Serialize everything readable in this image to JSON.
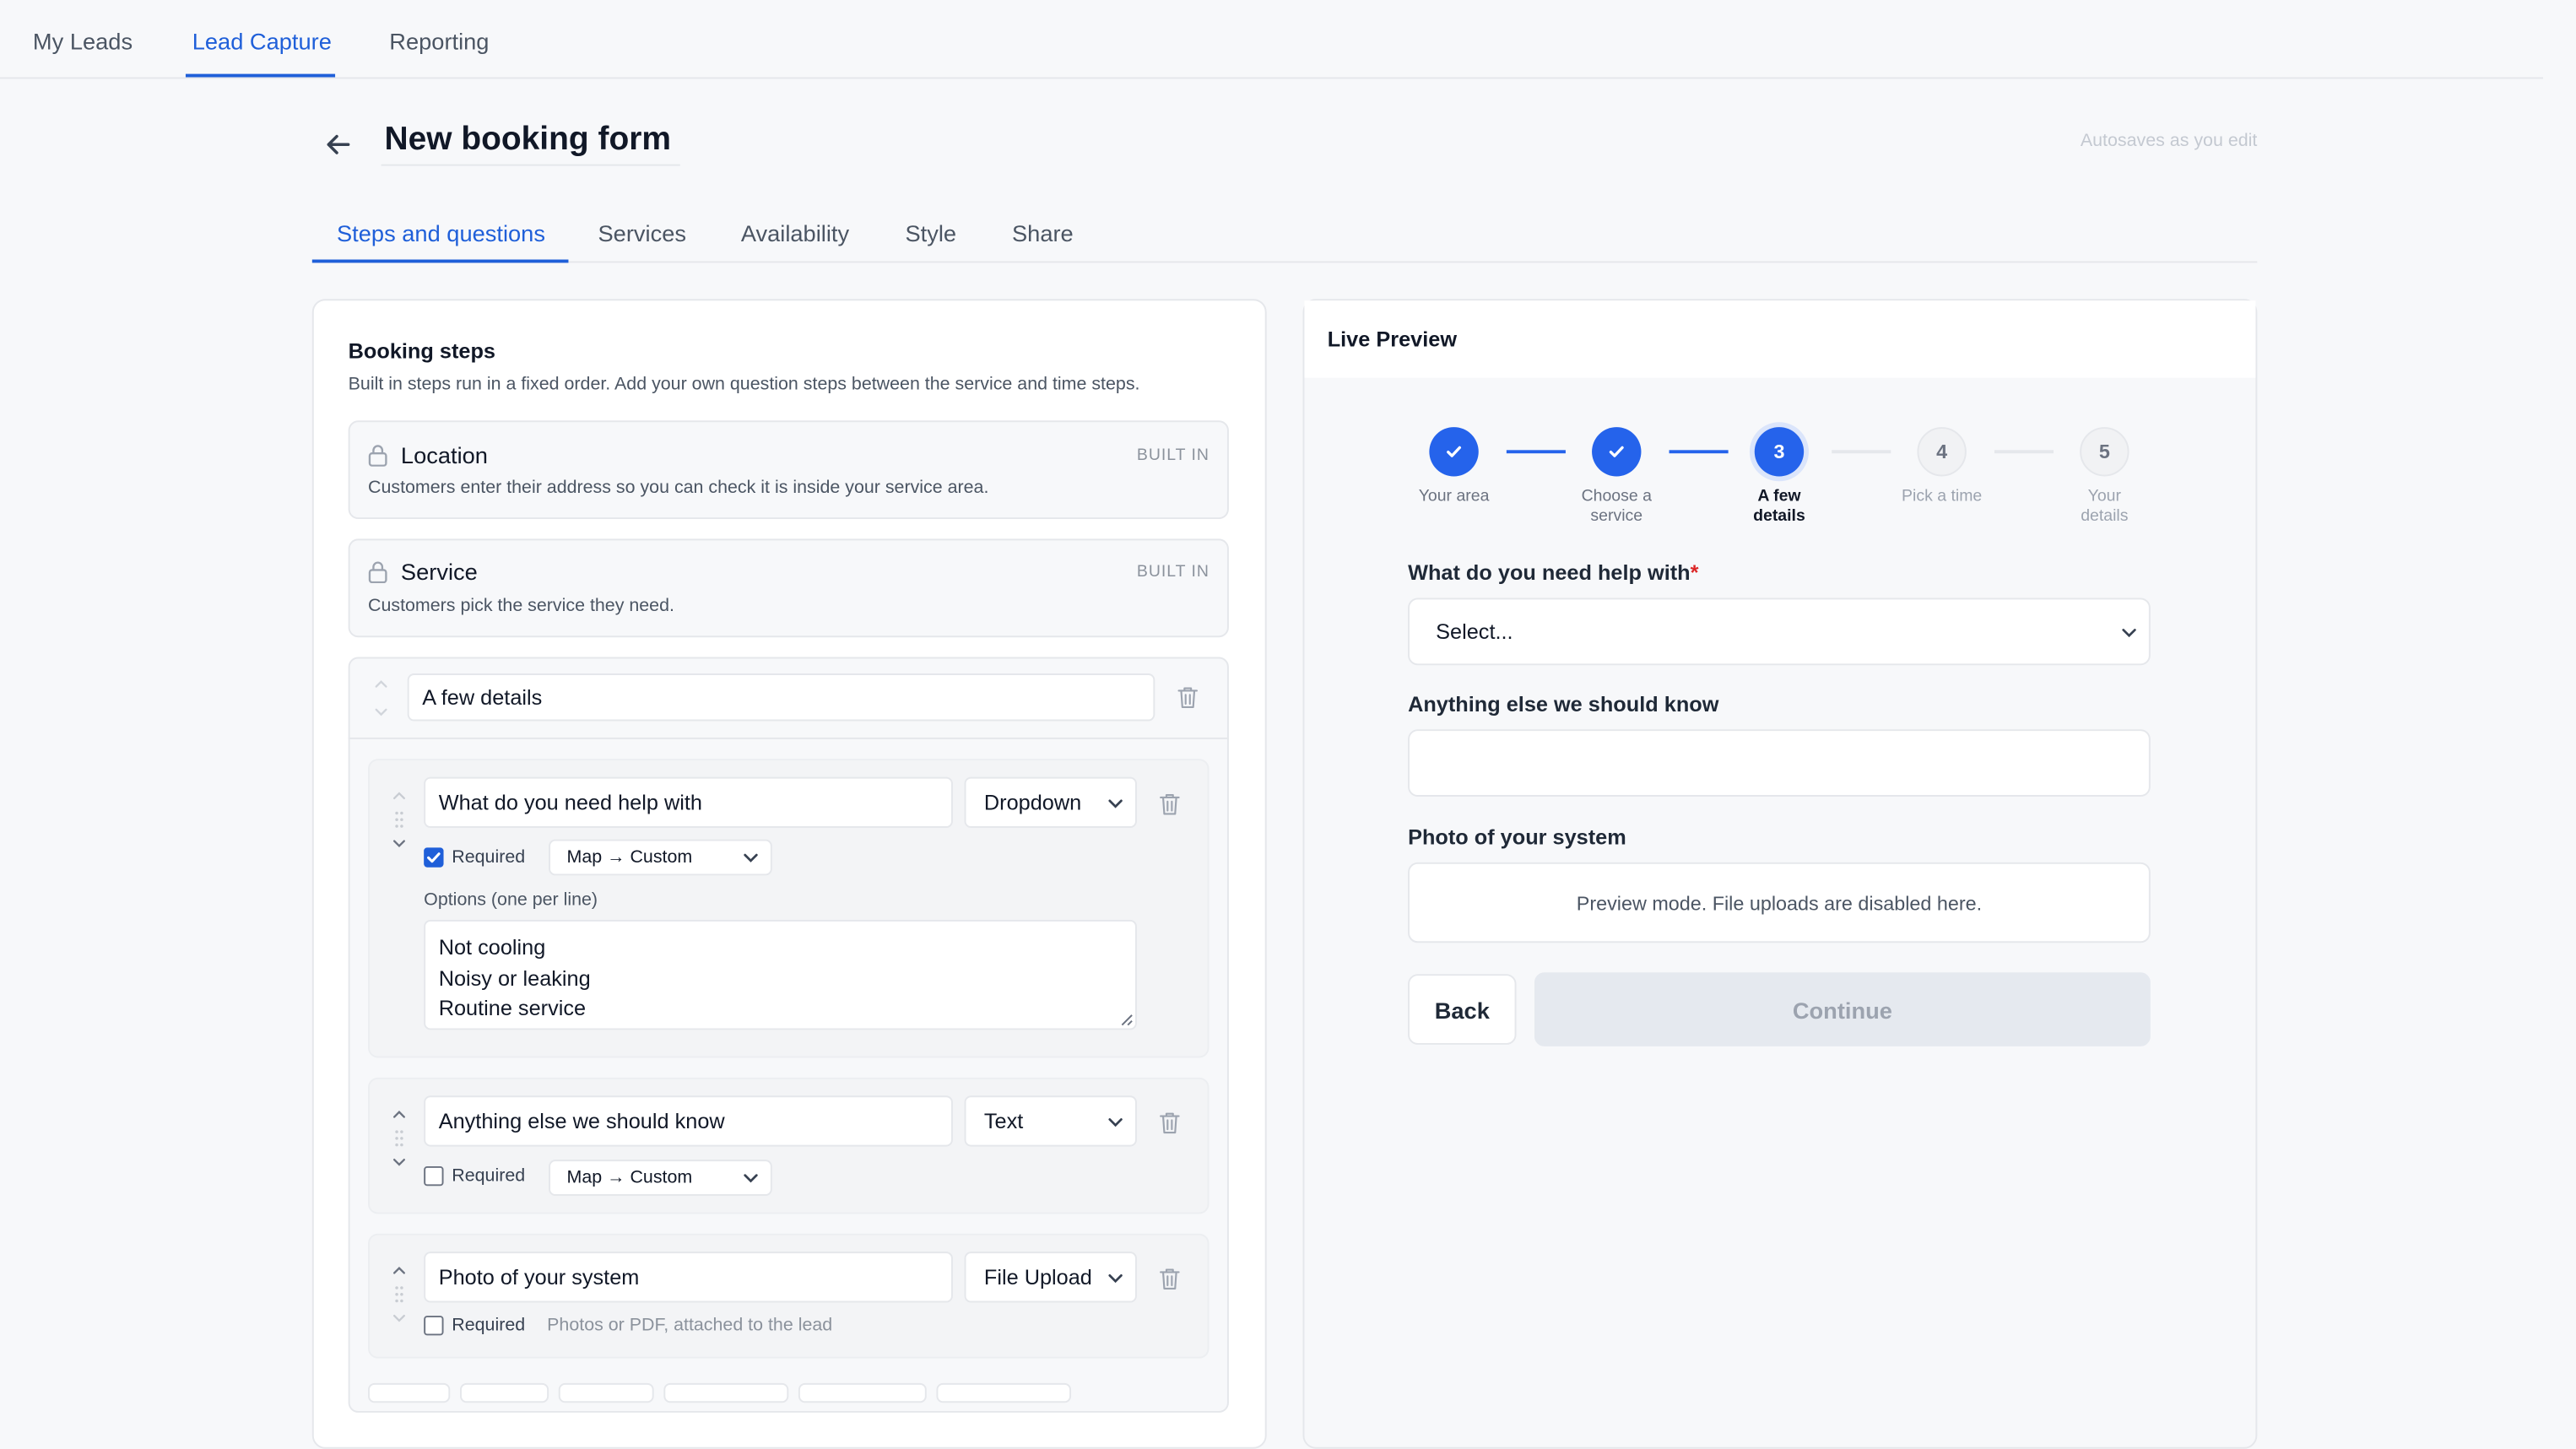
{
  "top_nav": {
    "tabs": [
      {
        "label": "My Leads"
      },
      {
        "label": "Lead Capture",
        "active": true
      },
      {
        "label": "Reporting"
      }
    ]
  },
  "header": {
    "title": "New booking form",
    "autosave": "Autosaves as you edit"
  },
  "sub_tabs": [
    {
      "label": "Steps and questions",
      "active": true
    },
    {
      "label": "Services"
    },
    {
      "label": "Availability"
    },
    {
      "label": "Style"
    },
    {
      "label": "Share"
    }
  ],
  "booking_steps": {
    "title": "Booking steps",
    "description": "Built in steps run in a fixed order. Add your own question steps between the service and time steps.",
    "builtin": [
      {
        "title": "Location",
        "badge": "BUILT IN",
        "description": "Customers enter their address so you can check it is inside your service area."
      },
      {
        "title": "Service",
        "badge": "BUILT IN",
        "description": "Customers pick the service they need."
      }
    ],
    "custom_step": {
      "name": "A few details",
      "questions": [
        {
          "label": "What do you need help with",
          "type": "Dropdown",
          "required": true,
          "required_label": "Required",
          "mapping": "Map → Custom",
          "options_label": "Options (one per line)",
          "options": [
            "Not cooling",
            "Noisy or leaking",
            "Routine service"
          ]
        },
        {
          "label": "Anything else we should know",
          "type": "Text",
          "required": false,
          "required_label": "Required",
          "mapping": "Map → Custom"
        },
        {
          "label": "Photo of your system",
          "type": "File Upload",
          "required": false,
          "required_label": "Required",
          "hint": "Photos or PDF, attached to the lead"
        }
      ]
    }
  },
  "preview": {
    "title": "Live Preview",
    "steps": [
      {
        "number": "1",
        "label": "Your area",
        "status": "done"
      },
      {
        "number": "2",
        "label": "Choose a service",
        "status": "done"
      },
      {
        "number": "3",
        "label": "A few details",
        "status": "current"
      },
      {
        "number": "4",
        "label": "Pick a time",
        "status": "todo"
      },
      {
        "number": "5",
        "label": "Your details",
        "status": "todo"
      }
    ],
    "fields": {
      "help_with": {
        "label": "What do you need help with",
        "required_mark": "*",
        "placeholder": "Select..."
      },
      "anything_else": {
        "label": "Anything else we should know",
        "value": ""
      },
      "photo": {
        "label": "Photo of your system",
        "notice": "Preview mode. File uploads are disabled here."
      }
    },
    "back_label": "Back",
    "continue_label": "Continue"
  },
  "colors": {
    "accent": "#1f5fd9",
    "step_done": "#2563eb",
    "required": "#dc2626",
    "disabled_button": "#e5e9ef"
  },
  "icons": {
    "back": "arrow-left-icon",
    "lock": "lock-icon",
    "trash": "trash-icon",
    "chevron": "chevron-down-icon",
    "check": "check-icon",
    "reorder": "reorder-arrows-icon"
  }
}
